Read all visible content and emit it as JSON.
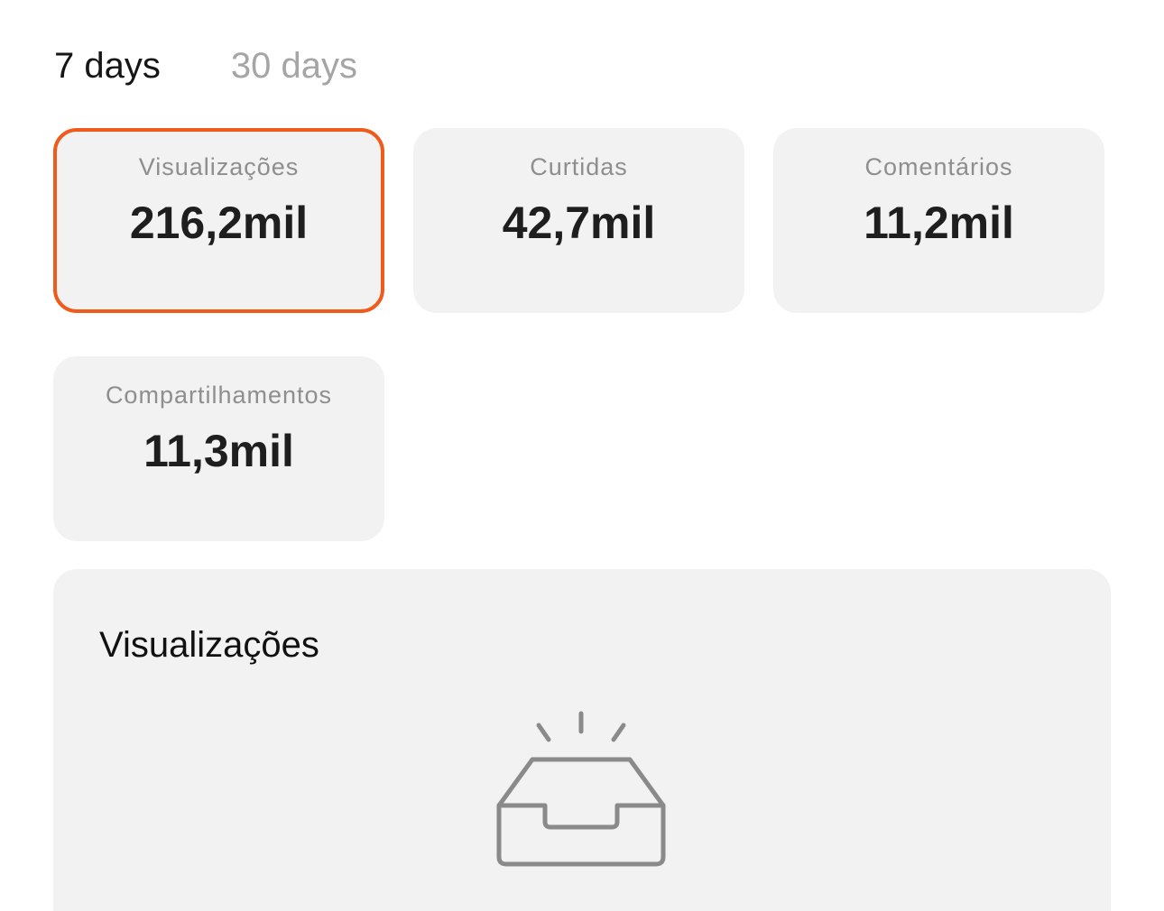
{
  "tabs": [
    {
      "label": "7 days",
      "active": true
    },
    {
      "label": "30 days",
      "active": false
    }
  ],
  "metrics": {
    "views": {
      "label": "Visualizações",
      "value": "216,2mil",
      "selected": true
    },
    "likes": {
      "label": "Curtidas",
      "value": "42,7mil",
      "selected": false
    },
    "comments": {
      "label": "Comentários",
      "value": "11,2mil",
      "selected": false
    },
    "shares": {
      "label": "Compartilhamentos",
      "value": "11,3mil",
      "selected": false
    }
  },
  "chart_panel": {
    "title": "Visualizações",
    "empty_state_icon": "empty-inbox-icon"
  },
  "colors": {
    "accent": "#f05a1a",
    "card_bg": "#f2f2f2",
    "inactive_tab": "#a5a5a5",
    "icon_gray": "#8a8a8a"
  }
}
